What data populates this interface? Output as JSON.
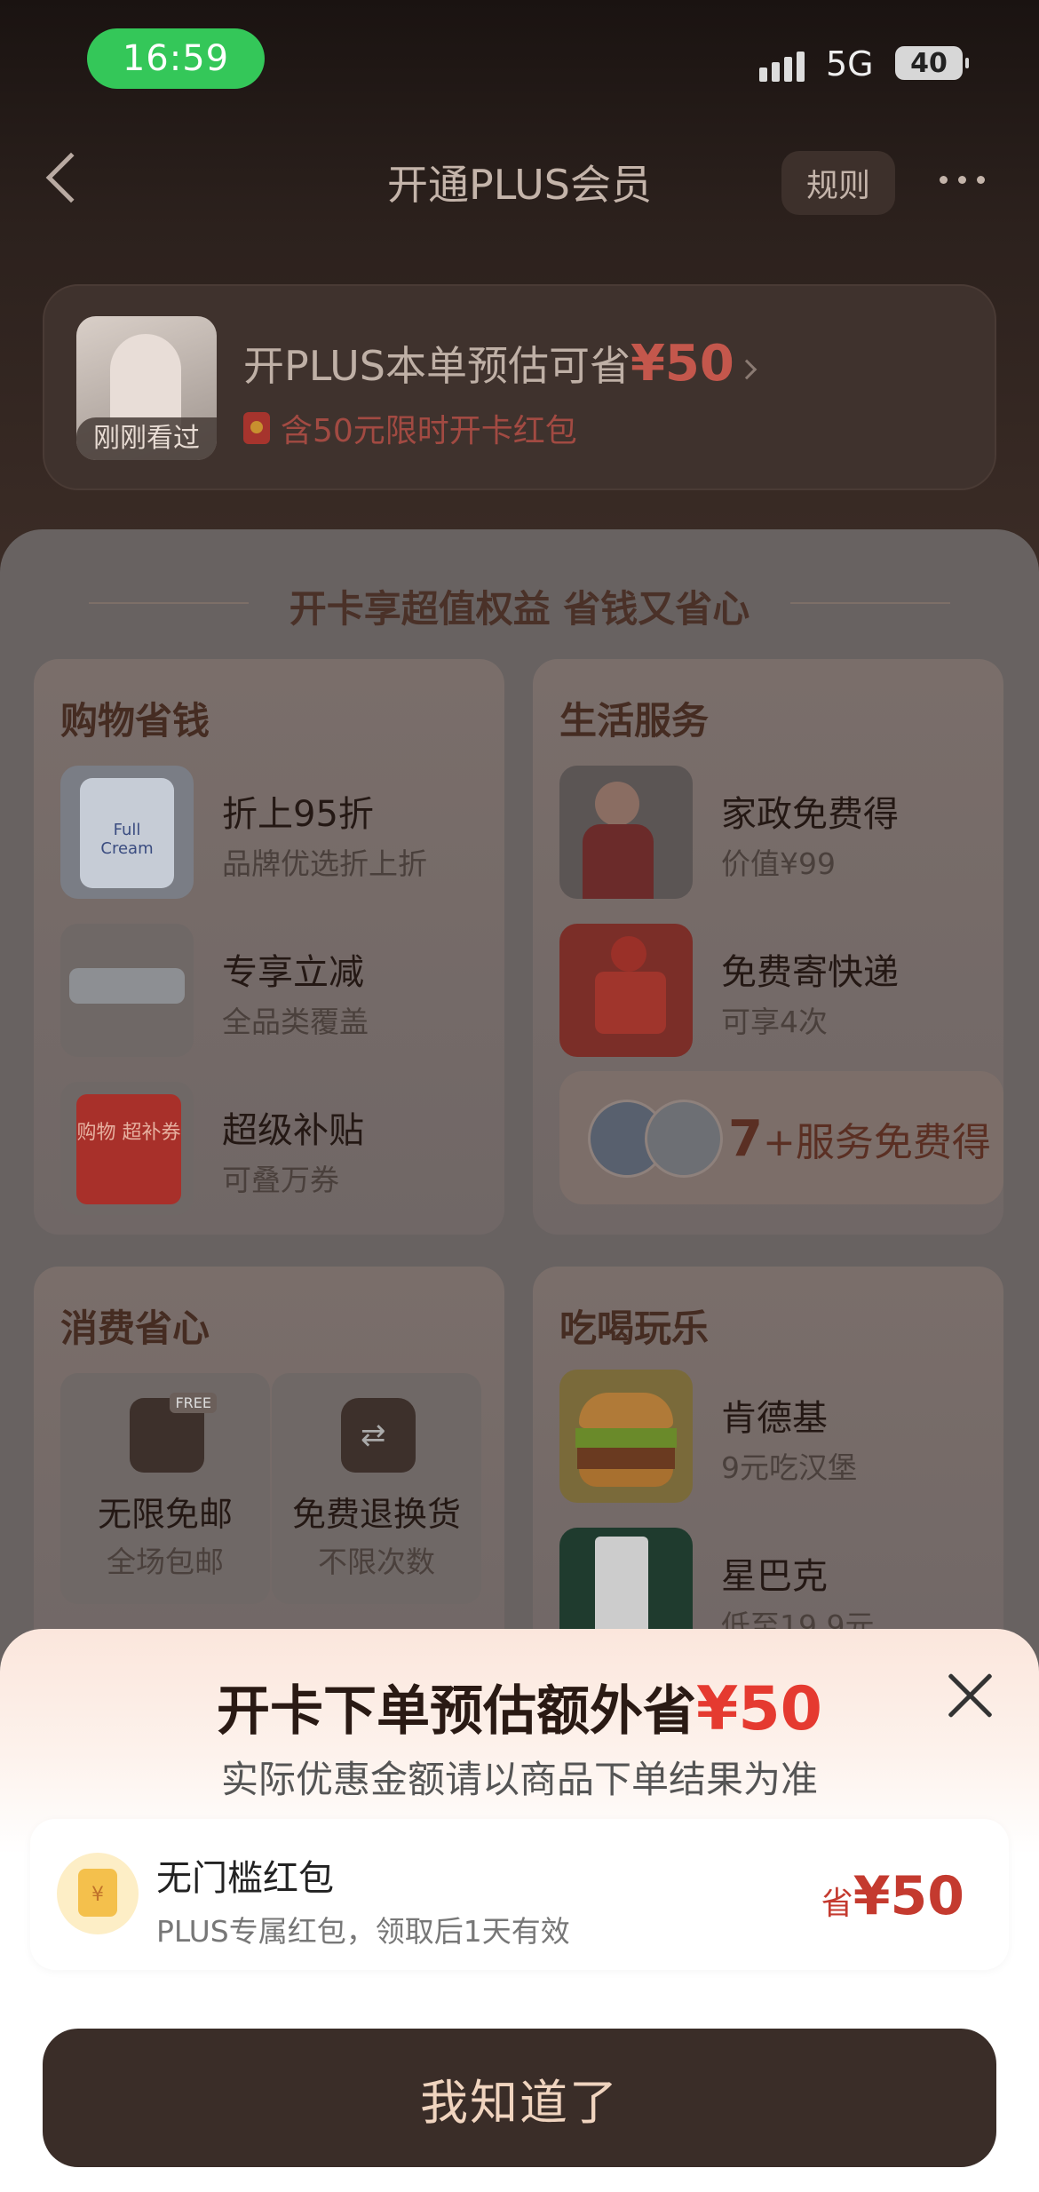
{
  "status_bar": {
    "time": "16:59",
    "network": "5G",
    "battery": "40"
  },
  "nav": {
    "title": "开通PLUS会员",
    "rules": "规则"
  },
  "banner": {
    "thumb_tag": "刚刚看过",
    "headline": "开PLUS本单预估可省",
    "amount": "¥50",
    "sub": "含50元限时开卡红包"
  },
  "benefits": {
    "title": "开卡享超值权益 省钱又省心",
    "shopping": {
      "title": "购物省钱",
      "items": [
        {
          "name": "折上95折",
          "desc": "品牌优选折上折",
          "image_text": "Full Cream"
        },
        {
          "name": "专享立减",
          "desc": "全品类覆盖"
        },
        {
          "name": "超级补贴",
          "desc": "可叠万券",
          "image_text": "购物 超补券"
        }
      ]
    },
    "life": {
      "title": "生活服务",
      "items": [
        {
          "name": "家政免费得",
          "desc": "价值¥99"
        },
        {
          "name": "免费寄快递",
          "desc": "可享4次"
        }
      ],
      "more_num": "7",
      "more_text": "+服务免费得"
    },
    "consume": {
      "title": "消费省心",
      "perks": [
        {
          "name": "无限免邮",
          "desc": "全场包邮",
          "icon_text": "FREE"
        },
        {
          "name": "免费退换货",
          "desc": "不限次数"
        }
      ]
    },
    "fun": {
      "title": "吃喝玩乐",
      "items": [
        {
          "name": "肯德基",
          "desc": "9元吃汉堡"
        },
        {
          "name": "星巴克",
          "desc": "低至19.9元"
        }
      ]
    }
  },
  "sheet": {
    "title": "开卡下单预估额外省",
    "amount": "¥50",
    "subtitle": "实际优惠金额请以商品下单结果为准",
    "coupon": {
      "name": "无门槛红包",
      "desc": "PLUS专属红包，领取后1天有效",
      "save_label": "省",
      "save_amount": "¥50",
      "icon_text": "¥"
    },
    "button": "我知道了"
  }
}
